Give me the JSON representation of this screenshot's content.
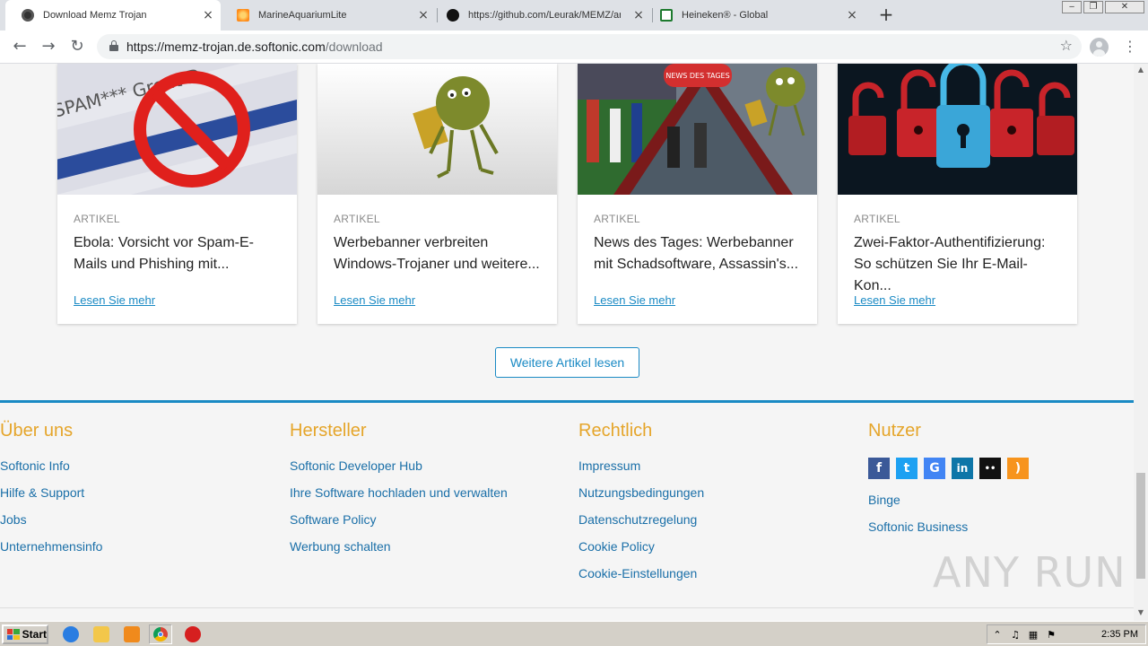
{
  "browser": {
    "tabs": [
      {
        "title": "Download Memz Trojan",
        "active": true
      },
      {
        "title": "MarineAquariumLite",
        "active": false
      },
      {
        "title": "https://github.com/Leurak/MEMZ/ar",
        "active": false
      },
      {
        "title": "Heineken® - Global",
        "active": false
      }
    ],
    "url": {
      "host": "https://memz-trojan.de.softonic.com",
      "path": "/download"
    }
  },
  "articles": [
    {
      "category": "ARTIKEL",
      "title": "Ebola: Vorsicht vor Spam-E-Mails und Phishing mit...",
      "link": "Lesen Sie mehr"
    },
    {
      "category": "ARTIKEL",
      "title": "Werbebanner verbreiten Windows-Trojaner und weitere...",
      "link": "Lesen Sie mehr"
    },
    {
      "category": "ARTIKEL",
      "title": "News des Tages: Werbebanner mit Schadsoftware, Assassin's...",
      "link": "Lesen Sie mehr"
    },
    {
      "category": "ARTIKEL",
      "title": "Zwei-Faktor-Authentifizierung: So schützen Sie Ihr E-Mail-Kon...",
      "link": "Lesen Sie mehr"
    }
  ],
  "thumb_texts": {
    "spam": "SPAM*** Great D",
    "news_badge": "NEWS DES TAGES"
  },
  "more_button": "Weitere Artikel lesen",
  "footer": {
    "about": {
      "heading": "Über uns",
      "links": [
        "Softonic Info",
        "Hilfe & Support",
        "Jobs",
        "Unternehmensinfo"
      ]
    },
    "makers": {
      "heading": "Hersteller",
      "links": [
        "Softonic Developer Hub",
        "Ihre Software hochladen und verwalten",
        "Software Policy",
        "Werbung schalten"
      ]
    },
    "legal": {
      "heading": "Rechtlich",
      "links": [
        "Impressum",
        "Nutzungsbedingungen",
        "Datenschutzregelung",
        "Cookie Policy",
        "Cookie-Einstellungen"
      ]
    },
    "users": {
      "heading": "Nutzer",
      "social": [
        {
          "icon": "facebook-icon",
          "glyph": "f",
          "color": "#3b5998"
        },
        {
          "icon": "twitter-icon",
          "glyph": "t",
          "color": "#1da1f2"
        },
        {
          "icon": "google-icon",
          "glyph": "G",
          "color": "#4285f4"
        },
        {
          "icon": "linkedin-icon",
          "glyph": "in",
          "color": "#0e76a8"
        },
        {
          "icon": "flickr-icon",
          "glyph": "••",
          "color": "#111111"
        },
        {
          "icon": "rss-icon",
          "glyph": ")",
          "color": "#f7941d"
        }
      ],
      "links": [
        "Binge",
        "Softonic Business"
      ]
    }
  },
  "watermark": "ANY RUN",
  "taskbar": {
    "start": "Start",
    "clock": "2:35 PM"
  },
  "colors": {
    "accent": "#1a8ac4",
    "heading": "#e5a52a",
    "link": "#1a6fa8"
  }
}
